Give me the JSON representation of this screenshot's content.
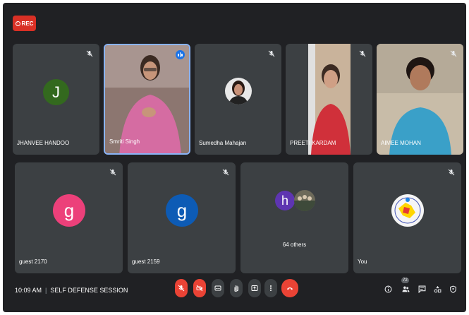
{
  "recording": {
    "label": "REC"
  },
  "participants": [
    {
      "name": "JHANVEE HANDOO",
      "initial": "J",
      "color": "#33691e"
    },
    {
      "name": "Smriti Singh",
      "speaking": true
    },
    {
      "name": "Sumedha Mahajan"
    },
    {
      "name": "PREETI KARDAM"
    },
    {
      "name": "AIMEE MOHAN"
    },
    {
      "name": "guest 2170",
      "initial": "g",
      "color": "#ec407a"
    },
    {
      "name": "guest 2159",
      "initial": "g",
      "color": "#0d5bb5"
    },
    {
      "name": "64 others",
      "initial": "h",
      "color": "#5e35b1"
    },
    {
      "name": "You"
    }
  ],
  "meeting": {
    "time": "10:09 AM",
    "title": "SELF DEFENSE SESSION"
  },
  "controls": [
    "mic-off",
    "camera-off",
    "captions",
    "raise-hand",
    "present",
    "more-options",
    "leave-call"
  ],
  "side_controls": {
    "people_count": "72"
  },
  "colors": {
    "background": "#202124",
    "tile": "#3c4043",
    "danger": "#ea4335",
    "accent": "#1a73e8"
  }
}
